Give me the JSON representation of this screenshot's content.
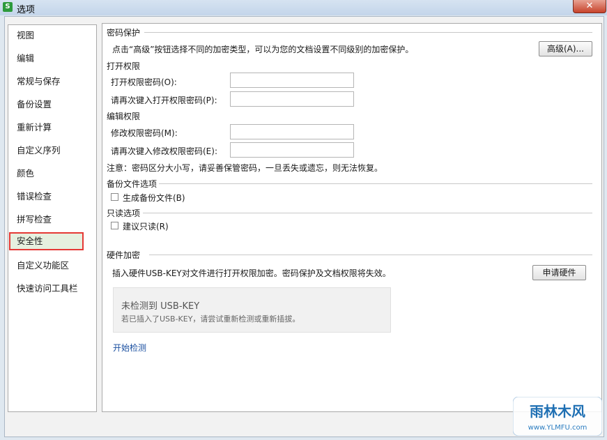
{
  "window": {
    "title": "选项",
    "app_icon": "S",
    "close_glyph": "✕"
  },
  "sidebar": {
    "items": [
      {
        "label": "视图"
      },
      {
        "label": "编辑"
      },
      {
        "label": "常规与保存"
      },
      {
        "label": "备份设置"
      },
      {
        "label": "重新计算"
      },
      {
        "label": "自定义序列"
      },
      {
        "label": "颜色"
      },
      {
        "label": "错误检查"
      },
      {
        "label": "拼写检查"
      },
      {
        "label": "安全性",
        "selected": true
      },
      {
        "label": "自定义功能区"
      },
      {
        "label": "快速访问工具栏"
      }
    ]
  },
  "password": {
    "section_title": "密码保护",
    "description": "点击“高级”按钮选择不同的加密类型，可以为您的文档设置不同级别的加密保护。",
    "advanced_button": "高级(A)...",
    "open_heading": "打开权限",
    "open_password_label": "打开权限密码(O):",
    "open_password_value": "",
    "open_confirm_label": "请再次键入打开权限密码(P):",
    "open_confirm_value": "",
    "edit_heading": "编辑权限",
    "edit_password_label": "修改权限密码(M):",
    "edit_password_value": "",
    "edit_confirm_label": "请再次键入修改权限密码(E):",
    "edit_confirm_value": "",
    "note": "注意：密码区分大小写，请妥善保管密码，一旦丢失或遗忘，则无法恢复。"
  },
  "backup": {
    "section_title": "备份文件选项",
    "checkbox_label": "生成备份文件(B)",
    "checked": false
  },
  "readonly": {
    "section_title": "只读选项",
    "checkbox_label": "建议只读(R)",
    "checked": false
  },
  "hardware": {
    "section_title": "硬件加密",
    "description": "插入硬件USB-KEY对文件进行打开权限加密。密码保护及文档权限将失效。",
    "apply_button": "申请硬件",
    "status_title": "未检测到 USB-KEY",
    "status_hint": "若已插入了USB-KEY，请尝试重新检测或重新插拔。",
    "detect_link": "开始检测"
  },
  "watermark": {
    "brand": "雨林木风",
    "url": "www.YLMFU.com"
  },
  "colors": {
    "selection_outline": "#e53935",
    "link": "#1a4fa0",
    "title_bar": "#c9d9ec"
  }
}
